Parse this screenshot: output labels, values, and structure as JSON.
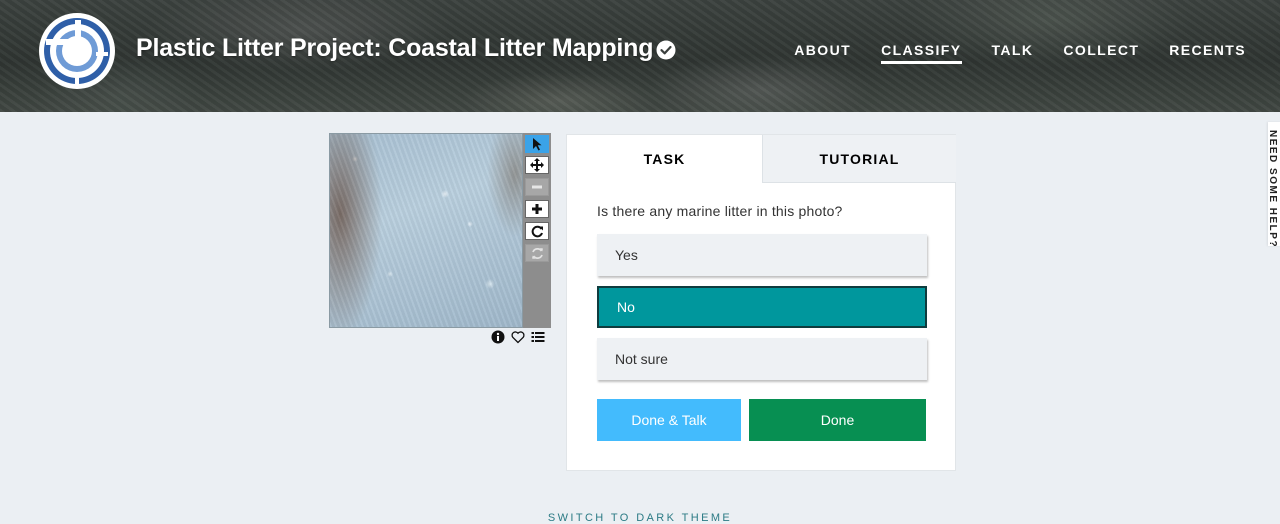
{
  "header": {
    "title": "Plastic Litter Project: Coastal Litter Mapping",
    "verified_icon": "check-circle-icon",
    "nav": [
      {
        "label": "ABOUT",
        "active": false
      },
      {
        "label": "CLASSIFY",
        "active": true
      },
      {
        "label": "TALK",
        "active": false
      },
      {
        "label": "COLLECT",
        "active": false
      },
      {
        "label": "RECENTS",
        "active": false
      }
    ]
  },
  "viewer": {
    "tools": [
      {
        "icon": "pointer-icon",
        "state": "active"
      },
      {
        "icon": "move-icon",
        "state": "enabled"
      },
      {
        "icon": "zoom-out-icon",
        "state": "disabled"
      },
      {
        "icon": "zoom-in-icon",
        "state": "enabled"
      },
      {
        "icon": "rotate-icon",
        "state": "enabled"
      },
      {
        "icon": "reset-icon",
        "state": "disabled"
      }
    ],
    "meta_icons": [
      "info-icon",
      "heart-icon",
      "list-icon"
    ]
  },
  "task": {
    "tabs": {
      "task": "TASK",
      "tutorial": "TUTORIAL"
    },
    "question": "Is there any marine litter in this photo?",
    "answers": [
      {
        "label": "Yes",
        "selected": false
      },
      {
        "label": "No",
        "selected": true
      },
      {
        "label": "Not sure",
        "selected": false
      }
    ],
    "done_talk_label": "Done & Talk",
    "done_label": "Done"
  },
  "side_tab": {
    "label": "NEED SOME HELP?"
  },
  "footer": {
    "theme_toggle": "SWITCH TO DARK THEME"
  },
  "colors": {
    "selected_answer": "#00979d",
    "done_talk": "#43bbfd",
    "done": "#078f52",
    "active_tool": "#3ba3e8"
  }
}
